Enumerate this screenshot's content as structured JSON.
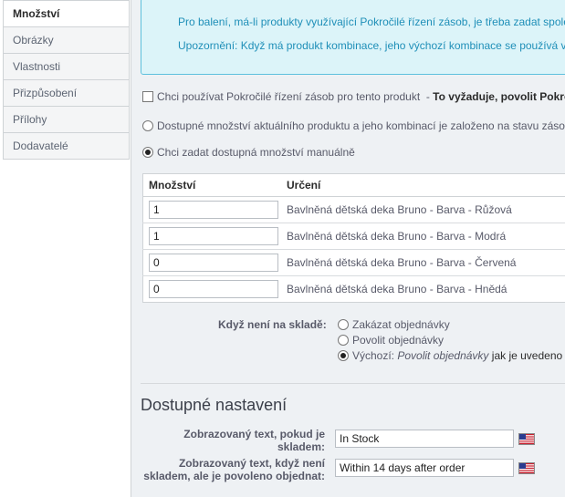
{
  "sidebar": {
    "items": [
      {
        "label": "Množství",
        "active": true
      },
      {
        "label": "Obrázky"
      },
      {
        "label": "Vlastnosti"
      },
      {
        "label": "Přizpůsobení"
      },
      {
        "label": "Přílohy"
      },
      {
        "label": "Dodavatelé"
      }
    ]
  },
  "info": {
    "line1": "Pro balení, má-li produkty využívající Pokročilé řízení zásob, je třeba zadat spole",
    "line2": "Upozornění: Když má produkt kombinace, jeho výchozí kombinace se používá v"
  },
  "options": {
    "advanced_stock": {
      "label": "Chci používat Pokročilé řízení zásob pro tento produkt",
      "suffix": "To vyžaduje, povolit Pokro"
    },
    "depends_on_stock": "Dostupné množství aktuálního produktu a jeho kombinací je založeno na stavu zásob",
    "manual": "Chci zadat dostupná množství manuálně"
  },
  "table": {
    "headers": {
      "qty": "Množství",
      "designation": "Určení"
    },
    "rows": [
      {
        "qty": "1",
        "designation": "Bavlněná dětská deka Bruno - Barva - Růžová"
      },
      {
        "qty": "1",
        "designation": "Bavlněná dětská deka Bruno - Barva - Modrá"
      },
      {
        "qty": "0",
        "designation": "Bavlněná dětská deka Bruno - Barva - Červená"
      },
      {
        "qty": "0",
        "designation": "Bavlněná dětská deka Bruno - Barva - Hnědá"
      }
    ]
  },
  "out_of_stock": {
    "label": "Když není na skladě:",
    "deny": "Zakázat objednávky",
    "allow": "Povolit objednávky",
    "default_prefix": "Výchozí:",
    "default_value": "Povolit objednávky",
    "default_suffix": "jak je uvedeno"
  },
  "availability": {
    "title": "Dostupné nastavení",
    "in_stock_label_1": "Zobrazovaný text, pokud je",
    "in_stock_label_2": "skladem:",
    "in_stock_value": "In Stock",
    "backorder_label_1": "Zobrazovaný text, když není",
    "backorder_label_2": "skladem, ale je povoleno objednat:",
    "backorder_value": "Within 14 days after order"
  },
  "colors": {
    "info_bg": "#dcf4f9",
    "info_border": "#5ec0dd",
    "info_text": "#1f8fb8"
  }
}
